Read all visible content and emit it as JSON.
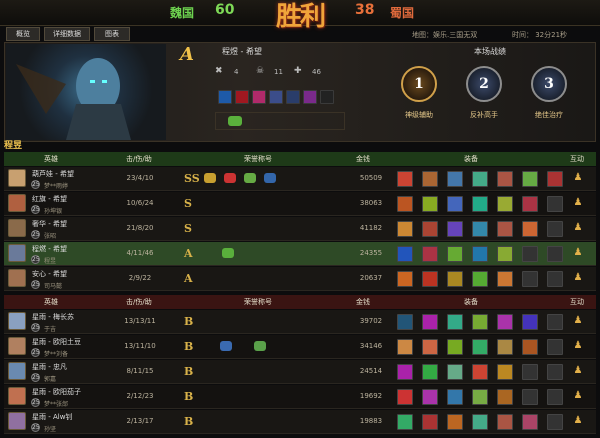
{
  "header": {
    "team_left": "魏国",
    "score_left": "60",
    "team_right": "蜀国",
    "score_right": "38",
    "victory": "胜利"
  },
  "tabs": [
    "概览",
    "详细数据",
    "图表"
  ],
  "match": {
    "map": "地图：娱乐.三国无双",
    "time": "时间：  32分21秒"
  },
  "profile": {
    "grade": "A",
    "name": "程煜 - 希望",
    "kills": "4",
    "deaths": "11",
    "assists": "46",
    "honors_title": "本场战绩",
    "medals": [
      {
        "num": "1",
        "label": "神级辅助"
      },
      {
        "num": "2",
        "label": "反补高手"
      },
      {
        "num": "3",
        "label": "绝佳治疗"
      }
    ]
  },
  "team1": {
    "name": "程昱",
    "headers": {
      "hero": "英雄",
      "kda": "击/伤/助",
      "honor": "荣誉称号",
      "gold": "金钱",
      "equip": "装备",
      "interact": "互动"
    },
    "rows": [
      {
        "hero": "葫芦娃 - 希望",
        "level": "25",
        "player": "梦**雨婷",
        "kda": "23/4/10",
        "grade": "SS",
        "gold": "50509"
      },
      {
        "hero": "红旗 - 希望",
        "level": "25",
        "player": "孙坤银",
        "kda": "10/6/24",
        "grade": "S",
        "gold": "38063"
      },
      {
        "hero": "奢华 - 希望",
        "level": "25",
        "player": "张昭",
        "kda": "21/8/20",
        "grade": "S",
        "gold": "41182"
      },
      {
        "hero": "程燃 - 希望",
        "level": "25",
        "player": "程昱",
        "kda": "4/11/46",
        "grade": "A",
        "gold": "24355"
      },
      {
        "hero": "安心 - 希望",
        "level": "25",
        "player": "司马懿",
        "kda": "2/9/22",
        "grade": "A",
        "gold": "20637"
      }
    ]
  },
  "team2": {
    "headers": {
      "hero": "英雄",
      "kda": "击/伤/助",
      "honor": "荣誉称号",
      "gold": "金钱",
      "equip": "装备",
      "interact": "互动"
    },
    "rows": [
      {
        "hero": "星雨 - 梅长苏",
        "level": "25",
        "player": "于吉",
        "kda": "13/13/11",
        "grade": "B",
        "gold": "39702"
      },
      {
        "hero": "星雨 - 欧阳土豆",
        "level": "25",
        "player": "梦**刘备",
        "kda": "13/11/10",
        "grade": "B",
        "gold": "34146"
      },
      {
        "hero": "星雨 - 忠凡",
        "level": "25",
        "player": "郭嘉",
        "kda": "8/11/15",
        "grade": "B",
        "gold": "24514"
      },
      {
        "hero": "星雨 - 欧阳茄子",
        "level": "25",
        "player": "梦**张郃",
        "kda": "2/12/23",
        "grade": "B",
        "gold": "19692"
      },
      {
        "hero": "星雨 - Alw钊",
        "level": "25",
        "player": "孙坚",
        "kda": "2/13/17",
        "grade": "B",
        "gold": "19883"
      }
    ]
  },
  "colors": {
    "team1_header": "#1e3a18",
    "team2_header": "#3a1412",
    "highlight_row": "#2e4a26"
  }
}
